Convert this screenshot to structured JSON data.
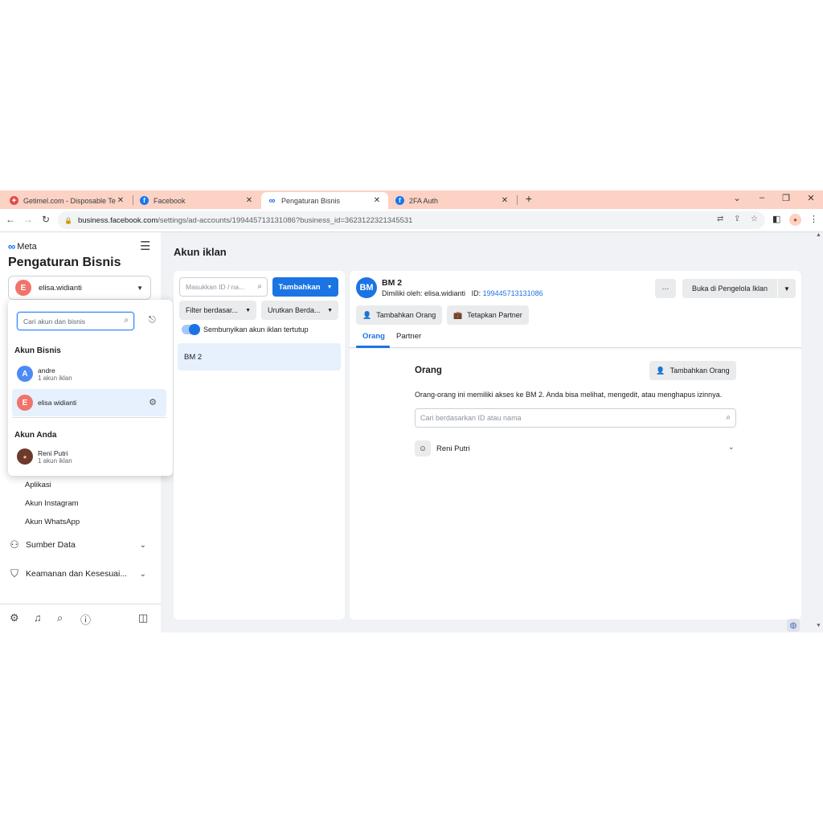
{
  "browser": {
    "tabs": [
      {
        "label": "Getimel.com - Disposable Temp",
        "icon": "getimel-icon",
        "active": false
      },
      {
        "label": "Facebook",
        "icon": "facebook-icon",
        "active": false
      },
      {
        "label": "Pengaturan Bisnis",
        "icon": "meta-icon",
        "active": true
      },
      {
        "label": "2FA Auth",
        "icon": "facebook-icon",
        "active": false
      }
    ],
    "url_host": "business.facebook.com",
    "url_path": "/settings/ad-accounts/199445713131086?business_id=3623122321345531"
  },
  "sidebar": {
    "brand": "Meta",
    "title": "Pengaturan Bisnis",
    "selected_account": {
      "initial": "E",
      "name": "elisa.widianti"
    },
    "items": [
      "Aplikasi",
      "Akun Instagram",
      "Akun WhatsApp"
    ],
    "sections": [
      {
        "label": "Sumber Data",
        "icon": "data-sources-icon"
      },
      {
        "label": "Keamanan dan Kesesuai...",
        "icon": "shield-icon"
      }
    ]
  },
  "popup": {
    "search_placeholder": "Cari akun dan bisnis",
    "business_heading": "Akun Bisnis",
    "businesses": [
      {
        "initial": "A",
        "name": "andre",
        "sub": "1 akun iklan",
        "color": "#4c8bf5"
      },
      {
        "initial": "E",
        "name": "elisa widianti",
        "sub": "",
        "color": "#f0736c"
      }
    ],
    "your_heading": "Akun Anda",
    "personal": {
      "name": "Reni Putri",
      "sub": "1 akun iklan"
    }
  },
  "main": {
    "page_title": "Akun iklan",
    "list": {
      "search_placeholder": "Masukkan ID / na...",
      "add_label": "Tambahkan",
      "filter_label": "Filter berdasar...",
      "sort_label": "Urutkan Berda...",
      "toggle_label": "Sembunyikan akun iklan tertutup",
      "rows": [
        "BM 2"
      ]
    },
    "detail": {
      "icon_glyph": "BM",
      "name": "BM 2",
      "owner_prefix": "Dimiliki oleh: elisa.widianti",
      "id_prefix": "ID:",
      "id_value": "199445713131086",
      "more_label": "···",
      "open_label": "Buka di Pengelola Iklan",
      "add_people_label": "Tambahkan Orang",
      "assign_partner_label": "Tetapkan Partner",
      "tabs": [
        "Orang",
        "Partner"
      ],
      "section_title": "Orang",
      "section_add_label": "Tambahkan Orang",
      "section_desc": "Orang-orang ini memiliki akses ke BM 2. Anda bisa melihat, mengedit, atau menghapus izinnya.",
      "people_search_placeholder": "Cari berdasarkan ID atau nama",
      "people": [
        {
          "name": "Reni Putri"
        }
      ]
    }
  },
  "colors": {
    "accent": "#1b74e4",
    "tab_strip": "#fbd2c4",
    "selected_row": "#e7f0fd"
  }
}
